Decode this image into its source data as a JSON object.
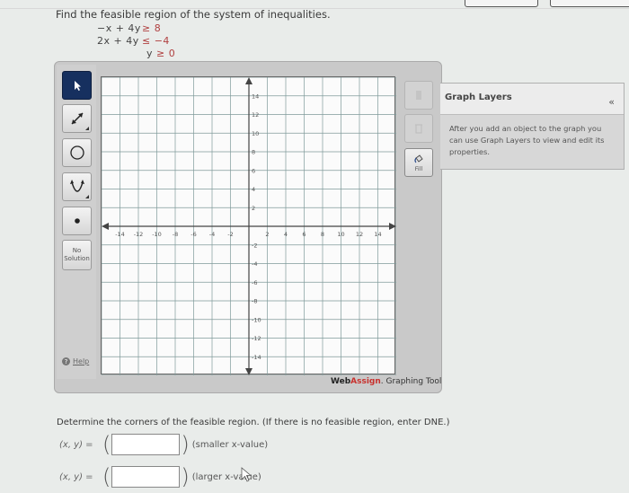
{
  "question": {
    "text": "Find the feasible region of the system of inequalities.",
    "inequalities": [
      {
        "lhs": "−x + 4y",
        "op": "≥",
        "rhs": "8"
      },
      {
        "lhs": "2x + 4y",
        "op": "≤",
        "rhs": "−4"
      },
      {
        "lhs": "y",
        "op": "≥",
        "rhs": "0"
      }
    ]
  },
  "left_toolbar": {
    "tools": [
      {
        "name": "pointer",
        "icon": "pointer-icon",
        "selected": true
      },
      {
        "name": "line",
        "icon": "line-icon",
        "selected": false
      },
      {
        "name": "circle",
        "icon": "circle-icon",
        "selected": false
      },
      {
        "name": "parabola",
        "icon": "parabola-icon",
        "selected": false
      },
      {
        "name": "point",
        "icon": "point-icon",
        "selected": false
      }
    ],
    "no_solution_line1": "No",
    "no_solution_line2": "Solution",
    "help_label": "Help"
  },
  "right_toolbar": {
    "fill_label": "Fill"
  },
  "graph": {
    "x_range": [
      -16,
      16
    ],
    "y_range": [
      -16,
      16
    ],
    "grid_step": 2,
    "x_tick_labels": [
      "-14",
      "-12",
      "-10",
      "-8",
      "-6",
      "-4",
      "-2",
      "2",
      "4",
      "6",
      "8",
      "10",
      "12",
      "14"
    ],
    "y_tick_labels": [
      "14",
      "12",
      "10",
      "8",
      "6",
      "4",
      "2",
      "-2",
      "-4",
      "-6",
      "-8",
      "-10",
      "-12",
      "-14"
    ]
  },
  "layers_panel": {
    "title": "Graph Layers",
    "collapse_glyph": "«",
    "body": "After you add an object to the graph you can use Graph Layers to view and edit its properties."
  },
  "branding": {
    "web": "Web",
    "assign": "Assign",
    "suffix": ". Graphing Tool"
  },
  "answers": {
    "prompt": "Determine the corners of the feasible region. (If there is no feasible region, enter DNE.)",
    "rows": [
      {
        "label": "(x, y) =",
        "value": "",
        "hint": "(smaller x-value)"
      },
      {
        "label": "(x, y) =",
        "value": "",
        "hint": "(larger x-value)"
      }
    ]
  }
}
